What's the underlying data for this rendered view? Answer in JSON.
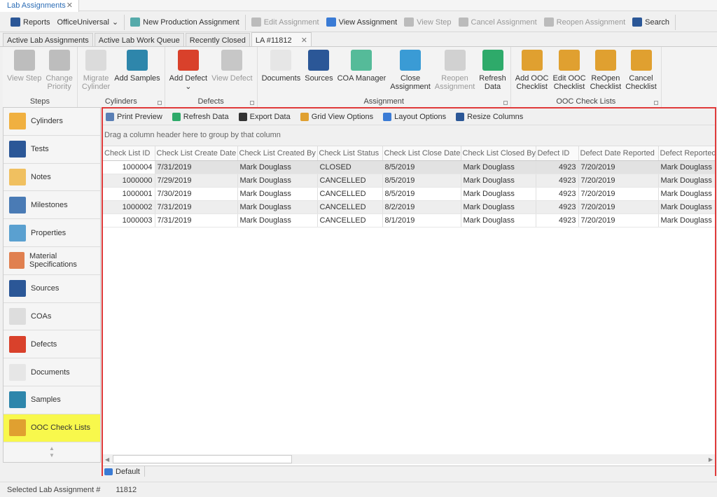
{
  "app": {
    "tab": "Lab Assignments"
  },
  "toolbar": [
    {
      "label": "Reports",
      "icon": "report-icon",
      "disabled": false,
      "color": "#2b5797"
    },
    {
      "label": "OfficeUniversal",
      "icon": "",
      "disabled": false,
      "dropdown": true
    },
    {
      "label": "New Production Assignment",
      "icon": "new-assignment-icon",
      "disabled": false,
      "color": "#5aa"
    },
    {
      "label": "Edit Assignment",
      "icon": "edit-assignment-icon",
      "disabled": true,
      "color": "#bbb"
    },
    {
      "label": "View Assignment",
      "icon": "view-assignment-icon",
      "disabled": false,
      "color": "#3a7bd5"
    },
    {
      "label": "View Step",
      "icon": "view-step-icon",
      "disabled": true,
      "color": "#bbb"
    },
    {
      "label": "Cancel Assignment",
      "icon": "cancel-assignment-icon",
      "disabled": true,
      "color": "#bbb"
    },
    {
      "label": "Reopen Assignment",
      "icon": "reopen-assignment-icon",
      "disabled": true,
      "color": "#bbb"
    },
    {
      "label": "Search",
      "icon": "search-icon",
      "disabled": false,
      "color": "#2b5797"
    }
  ],
  "doc_tabs": [
    {
      "label": "Active Lab Assignments"
    },
    {
      "label": "Active Lab Work Queue"
    },
    {
      "label": "Recently Closed"
    },
    {
      "label": "LA #11812",
      "active": true,
      "closable": true
    }
  ],
  "ribbon": [
    {
      "group": "Steps",
      "buttons": [
        {
          "l1": "View Step",
          "l2": "",
          "dis": true,
          "c": "#999"
        },
        {
          "l1": "Change",
          "l2": "Priority",
          "dis": true,
          "c": "#999"
        }
      ]
    },
    {
      "group": "Cylinders",
      "launcher": true,
      "buttons": [
        {
          "l1": "Migrate",
          "l2": "Cylinder",
          "dis": true,
          "c": "#ccc"
        },
        {
          "l1": "Add Samples",
          "l2": "",
          "dis": false,
          "c": "#2e86ab"
        }
      ]
    },
    {
      "group": "Defects",
      "launcher": true,
      "buttons": [
        {
          "l1": "Add Defect",
          "l2": "⌄",
          "dis": false,
          "c": "#d9412b"
        },
        {
          "l1": "View Defect",
          "l2": "",
          "dis": true,
          "c": "#aaa"
        }
      ]
    },
    {
      "group": "Assignment",
      "launcher": true,
      "buttons": [
        {
          "l1": "Documents",
          "l2": "",
          "dis": false,
          "c": "#e6e6e6"
        },
        {
          "l1": "Sources",
          "l2": "",
          "dis": false,
          "c": "#2b5797"
        },
        {
          "l1": "COA Manager",
          "l2": "",
          "dis": false,
          "c": "#5b9"
        },
        {
          "l1": "Close",
          "l2": "Assignment",
          "dis": false,
          "c": "#3a9bd5"
        },
        {
          "l1": "Reopen",
          "l2": "Assignment",
          "dis": true,
          "c": "#bbb"
        },
        {
          "l1": "Refresh",
          "l2": "Data",
          "dis": false,
          "c": "#2eaa6a"
        }
      ]
    },
    {
      "group": "OOC Check Lists",
      "launcher": true,
      "buttons": [
        {
          "l1": "Add OOC",
          "l2": "Checklist",
          "dis": false,
          "c": "#e0a030"
        },
        {
          "l1": "Edit OOC",
          "l2": "Checklist",
          "dis": false,
          "c": "#e0a030"
        },
        {
          "l1": "ReOpen",
          "l2": "Checklist",
          "dis": false,
          "c": "#e0a030"
        },
        {
          "l1": "Cancel",
          "l2": "Checklist",
          "dis": false,
          "c": "#e0a030"
        }
      ]
    }
  ],
  "nav": [
    {
      "label": "Cylinders",
      "icon": "cylinder-icon",
      "c": "#f0b040"
    },
    {
      "label": "Tests",
      "icon": "tests-icon",
      "c": "#2b5797"
    },
    {
      "label": "Notes",
      "icon": "notes-icon",
      "c": "#f0c060"
    },
    {
      "label": "Milestones",
      "icon": "milestones-icon",
      "c": "#4a7bb5"
    },
    {
      "label": "Properties",
      "icon": "properties-icon",
      "c": "#5aa0d0"
    },
    {
      "label": "Material Specifications",
      "icon": "material-spec-icon",
      "c": "#e08050"
    },
    {
      "label": "Sources",
      "icon": "sources-icon",
      "c": "#2b5797"
    },
    {
      "label": "COAs",
      "icon": "coa-icon",
      "c": "#ddd"
    },
    {
      "label": "Defects",
      "icon": "defects-icon",
      "c": "#d9412b"
    },
    {
      "label": "Documents",
      "icon": "documents-icon",
      "c": "#e6e6e6"
    },
    {
      "label": "Samples",
      "icon": "samples-icon",
      "c": "#2e86ab"
    },
    {
      "label": "OOC Check Lists",
      "icon": "ooc-checklist-icon",
      "c": "#e0a030",
      "selected": true
    }
  ],
  "grid_toolbar": [
    {
      "label": "Print Preview",
      "icon": "print-preview-icon",
      "c": "#5a7fb5"
    },
    {
      "label": "Refresh Data",
      "icon": "refresh-icon",
      "c": "#2eaa6a"
    },
    {
      "label": "Export Data",
      "icon": "export-icon",
      "c": "#333"
    },
    {
      "label": "Grid View Options",
      "icon": "grid-options-icon",
      "c": "#e0a030"
    },
    {
      "label": "Layout Options",
      "icon": "layout-options-icon",
      "c": "#3a7bd5"
    },
    {
      "label": "Resize Columns",
      "icon": "resize-columns-icon",
      "c": "#2b5797"
    }
  ],
  "group_panel": "Drag a column header here to group by that column",
  "grid": {
    "columns": [
      "Check List ID",
      "Check List Create Date",
      "Check List Created By",
      "Check List Status",
      "Check List Close Date",
      "Check List Closed By",
      "Defect ID",
      "Defect Date Reported",
      "Defect Reported By"
    ],
    "rows": [
      [
        "1000004",
        "7/31/2019",
        "Mark Douglass",
        "CLOSED",
        "8/5/2019",
        "Mark Douglass",
        "4923",
        "7/20/2019",
        "Mark Douglass"
      ],
      [
        "1000000",
        "7/29/2019",
        "Mark Douglass",
        "CANCELLED",
        "8/5/2019",
        "Mark Douglass",
        "4923",
        "7/20/2019",
        "Mark Douglass"
      ],
      [
        "1000001",
        "7/30/2019",
        "Mark Douglass",
        "CANCELLED",
        "8/5/2019",
        "Mark Douglass",
        "4923",
        "7/20/2019",
        "Mark Douglass"
      ],
      [
        "1000002",
        "7/31/2019",
        "Mark Douglass",
        "CANCELLED",
        "8/2/2019",
        "Mark Douglass",
        "4923",
        "7/20/2019",
        "Mark Douglass"
      ],
      [
        "1000003",
        "7/31/2019",
        "Mark Douglass",
        "CANCELLED",
        "8/1/2019",
        "Mark Douglass",
        "4923",
        "7/20/2019",
        "Mark Douglass"
      ]
    ]
  },
  "bottom_tab": "Default",
  "status": {
    "label": "Selected Lab Assignment #",
    "value": "11812"
  },
  "colors": {
    "highlight_border": "#e03a3a",
    "selected_nav": "#f8f84c",
    "accent": "#2b6cb5"
  }
}
